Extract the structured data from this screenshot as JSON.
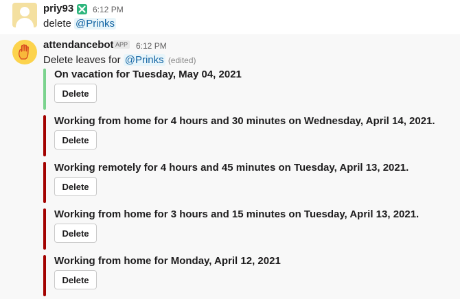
{
  "messages": [
    {
      "user": "priy93",
      "status_icon": "green-check-square-icon",
      "time": "6:12 PM",
      "text_prefix": "delete ",
      "mention": "@Prinks"
    },
    {
      "user": "attendancebot",
      "app_tag": "APP",
      "time": "6:12 PM",
      "text_prefix": "Delete leaves for ",
      "mention": "@Prinks",
      "edited": "(edited)"
    }
  ],
  "attachments": [
    {
      "title": "On vacation for Tuesday, May 04, 2021",
      "button": "Delete",
      "color": "#7bd38e"
    },
    {
      "title": "Working from home for 4 hours and 30 minutes on Wednesday, April 14, 2021.",
      "button": "Delete",
      "color": "#a30200"
    },
    {
      "title": "Working remotely for 4 hours and 45 minutes on Tuesday, April 13, 2021.",
      "button": "Delete",
      "color": "#a30200"
    },
    {
      "title": "Working from home for 3 hours and 15 minutes on Tuesday, April 13, 2021.",
      "button": "Delete",
      "color": "#a30200"
    },
    {
      "title": "Working from home for Monday, April 12, 2021",
      "button": "Delete",
      "color": "#a30200"
    }
  ]
}
